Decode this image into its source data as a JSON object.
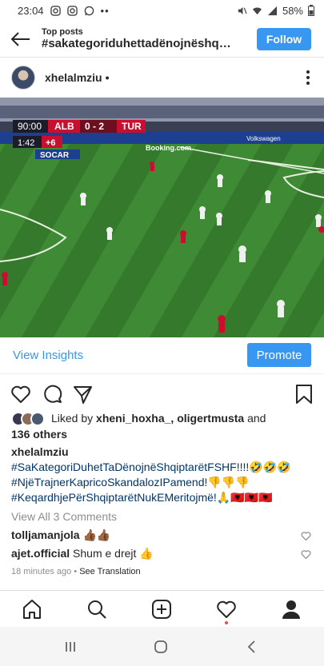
{
  "status_bar": {
    "time": "23:04",
    "battery": "58%"
  },
  "header": {
    "subtitle": "Top posts",
    "hashtag": "#sakategoriduhettadënojnëshqip...",
    "follow_label": "Follow"
  },
  "post": {
    "username": "xhelalmziu",
    "dot": "•",
    "scoreboard": {
      "time": "90:00",
      "home": "ALB",
      "score": "0 - 2",
      "away": "TUR",
      "sub_time": "1:42",
      "added": "+6",
      "sponsor": "SOCAR"
    },
    "banner_text": "Booking.com",
    "banner_text2": "Volkswagen"
  },
  "insights": {
    "view_label": "View Insights",
    "promote_label": "Promote"
  },
  "likes": {
    "prefix": "Liked by ",
    "users": "xheni_hoxha_, oligertmusta",
    "and": " and",
    "others": "136 others"
  },
  "caption": {
    "username": "xhelalmziu",
    "lines": [
      "#SaKategoriDuhetTaDënojnëShqiptarëtFSHF!!!!🤣🤣🤣",
      "#NjëTrajnerKapricoSkandalozIPamend!👎👎👎",
      "#KeqardhjePërShqiptarëtNukEMeritojmë!🙏🇦🇱🇦🇱🇦🇱"
    ]
  },
  "comments": {
    "view_all": "View All 3 Comments",
    "items": [
      {
        "user": "tolljamanjola",
        "text": "👍🏾👍🏾"
      },
      {
        "user": "ajet.official",
        "text": "Shum e drejt 👍"
      }
    ],
    "time": "18 minutes ago",
    "sep": " • ",
    "translate": "See Translation"
  },
  "colors": {
    "accent": "#3897f0",
    "pitch": "#3f8a34",
    "notif": "#ed4956"
  }
}
